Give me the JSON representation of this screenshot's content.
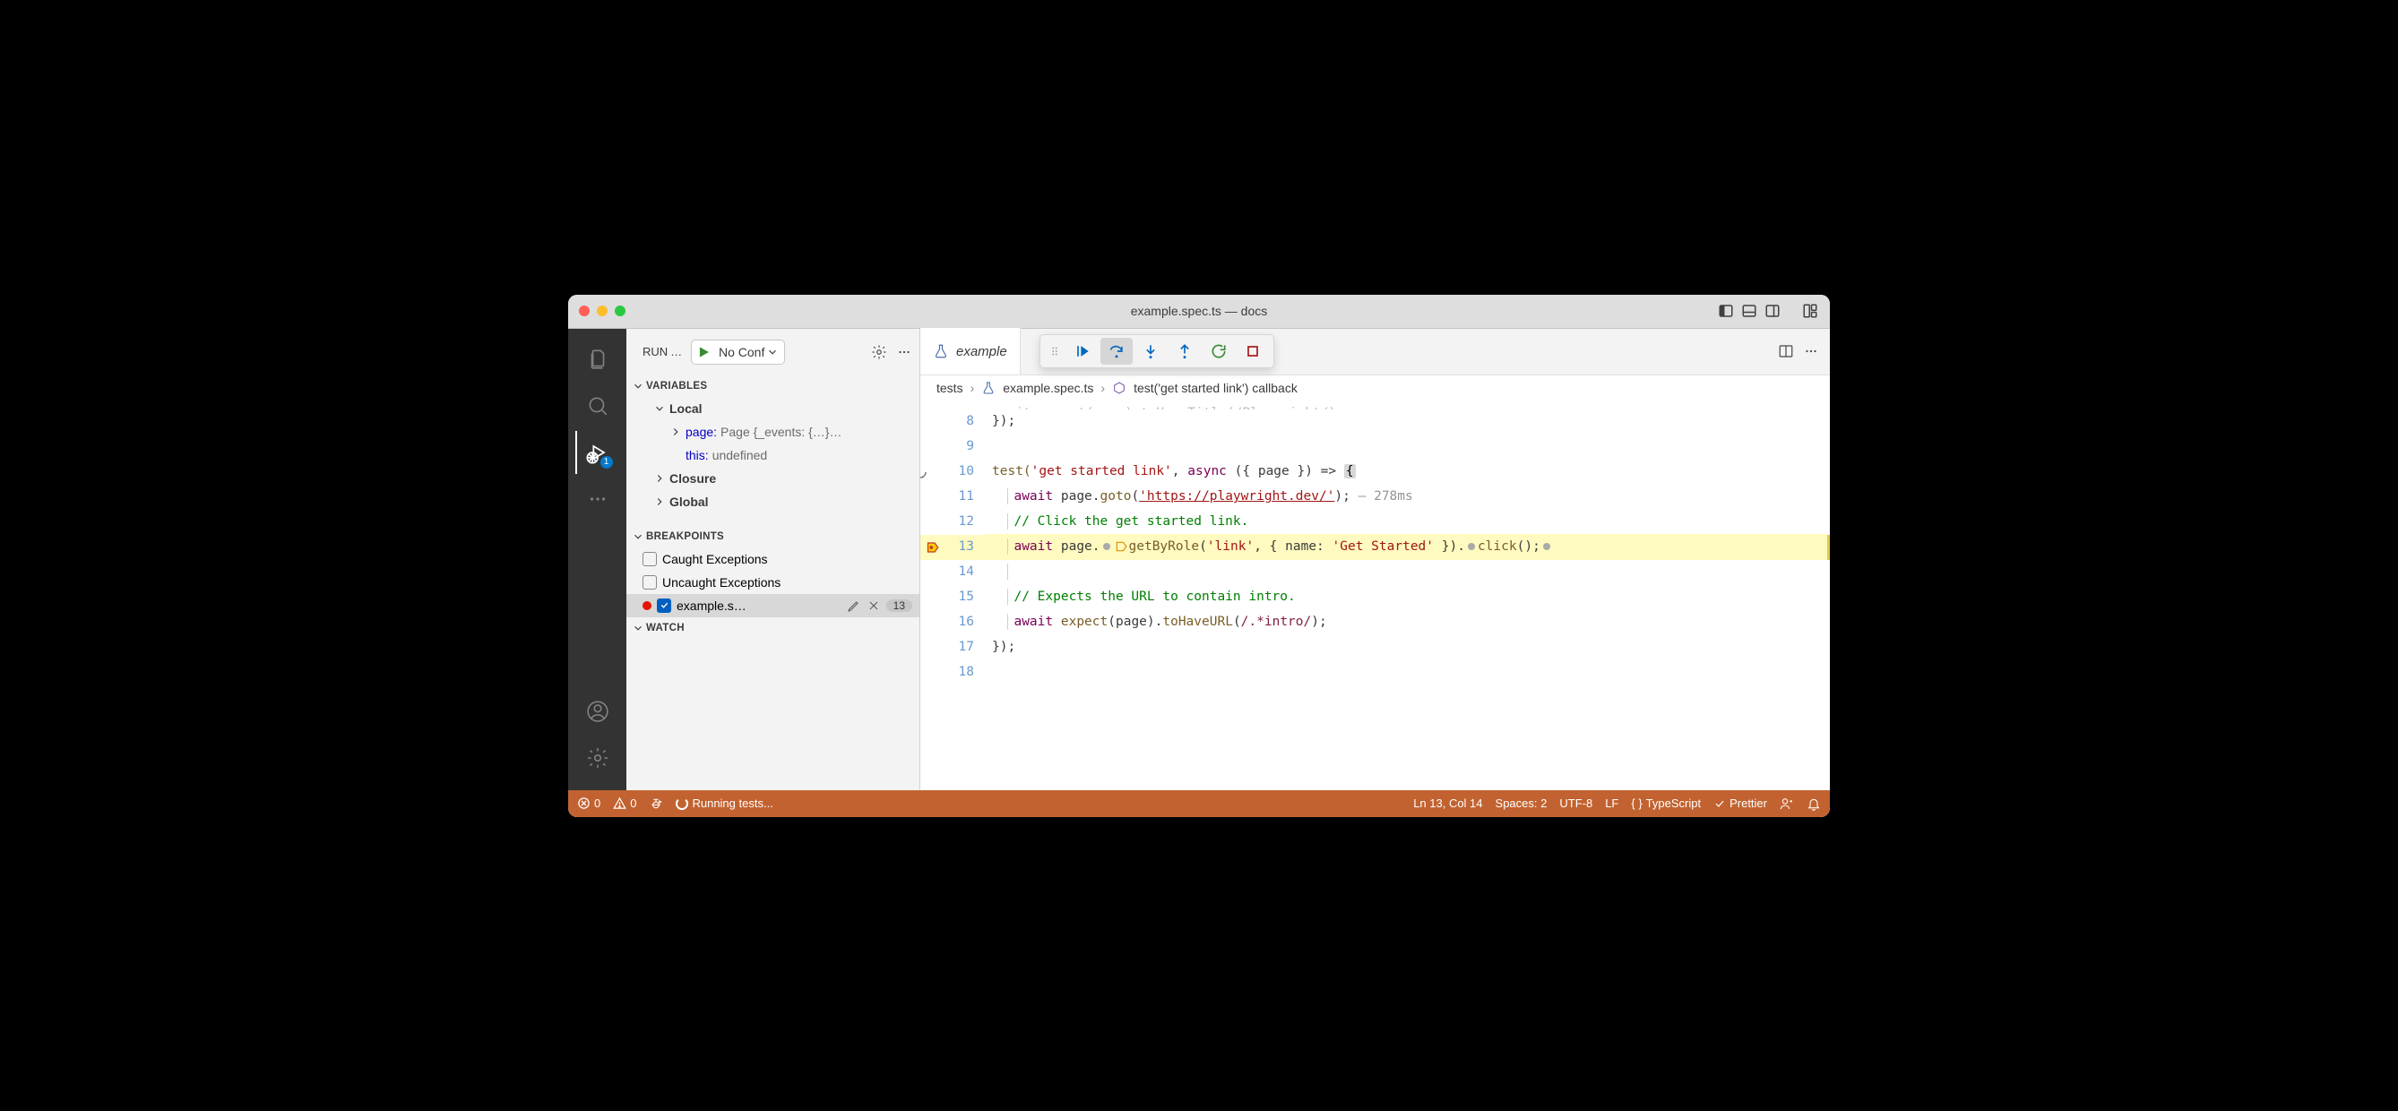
{
  "title": "example.spec.ts — docs",
  "activityBar": {
    "debugBadge": "1"
  },
  "sidebar": {
    "headerLabel": "RUN AND DEBUG",
    "config": "No Conf",
    "sections": {
      "variables": "VARIABLES",
      "breakpoints": "BREAKPOINTS",
      "watch": "WATCH"
    },
    "variables": {
      "local": "Local",
      "page": {
        "name": "page:",
        "value": "Page {_events: {…}…"
      },
      "this": {
        "name": "this:",
        "value": "undefined"
      },
      "closure": "Closure",
      "global": "Global"
    },
    "breakpoints": {
      "caught": "Caught Exceptions",
      "uncaught": "Uncaught Exceptions",
      "file": "example.s…",
      "line": "13"
    }
  },
  "tab": {
    "label": "example"
  },
  "breadcrumb": {
    "tests": "tests",
    "file": "example.spec.ts",
    "symbol": "test('get started link') callback"
  },
  "code": {
    "l8": "});",
    "l10_pre": "test(",
    "l10_str": "'get started link'",
    "l10_mid": ", ",
    "l10_async": "async",
    "l10_post": " ({ page }) => ",
    "l11_await": "await",
    "l11_mid": " page.",
    "l11_fn": "goto",
    "l11_p1": "(",
    "l11_url": "'https://playwright.dev/'",
    "l11_p2": "); ",
    "l11_hint": "— 278ms",
    "l12": "// Click the get started link.",
    "l13_await": "await",
    "l13_a": " page.",
    "l13_fn": "getByRole",
    "l13_p1": "(",
    "l13_s1": "'link'",
    "l13_c": ", { name: ",
    "l13_s2": "'Get Started'",
    "l13_p2": " }).",
    "l13_fn2": "click",
    "l13_p3": "();",
    "l15": "// Expects the URL to contain intro.",
    "l16_await": "await",
    "l16_a": " ",
    "l16_fn1": "expect",
    "l16_p1": "(page).",
    "l16_fn2": "toHaveURL",
    "l16_p2": "(",
    "l16_rx": "/.*intro/",
    "l16_p3": ");",
    "l17": "});"
  },
  "statusBar": {
    "errors": "0",
    "warnings": "0",
    "running": "Running tests...",
    "lncol": "Ln 13, Col 14",
    "spaces": "Spaces: 2",
    "encoding": "UTF-8",
    "eol": "LF",
    "lang": "TypeScript",
    "prettier": "Prettier"
  }
}
